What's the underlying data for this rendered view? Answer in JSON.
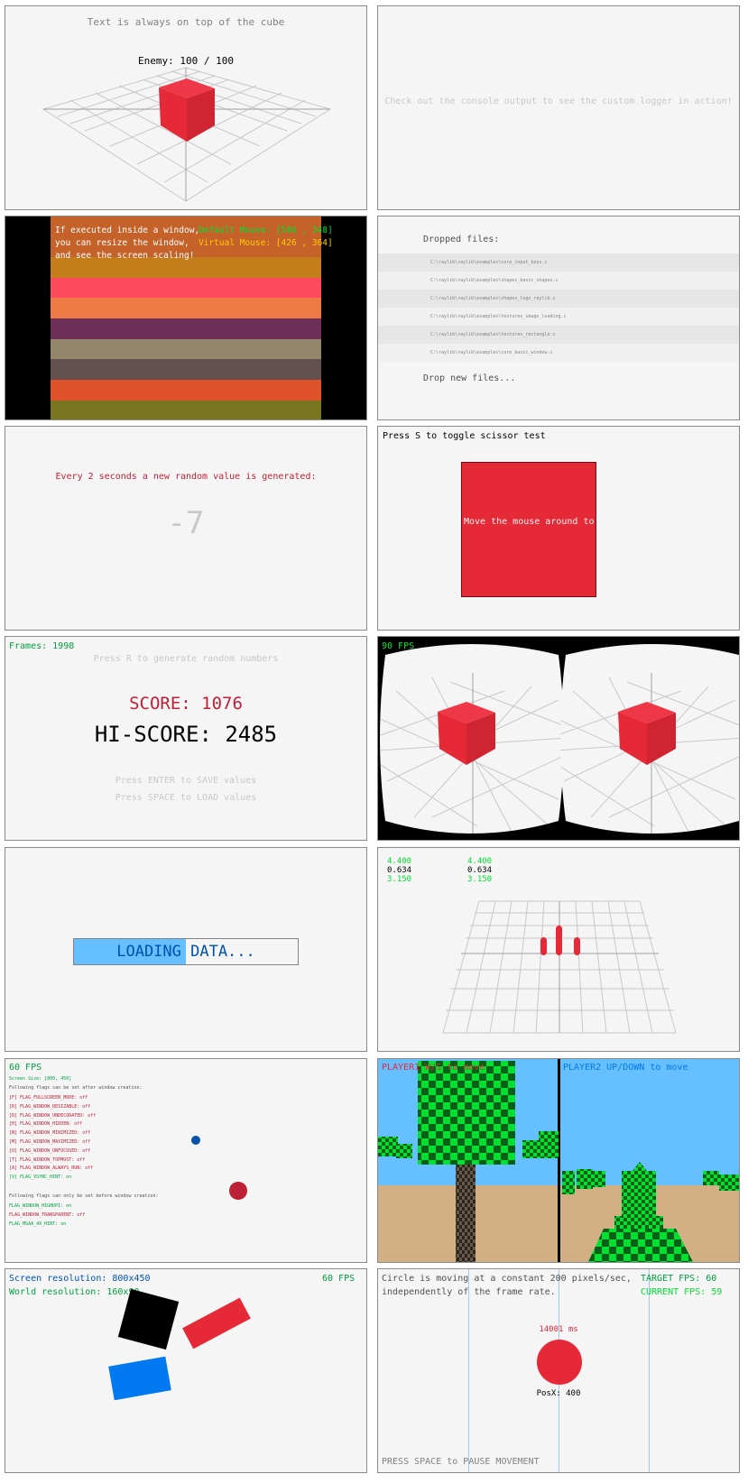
{
  "colors": {
    "red": "#e62937",
    "lightgray": "#c8c8c8",
    "gray": "#828282",
    "darkgray": "#505050",
    "lime": "#00e030",
    "green": "#00a040",
    "darkblue": "#0052ac",
    "blue": "#0079f1",
    "skyblue": "#66bfff",
    "maroon": "#be2137",
    "gold": "#ffcb00",
    "beige": "#d3b083",
    "black": "#000000",
    "raywhite": "#f5f5f5"
  },
  "p1": {
    "title": "Text is always on top of the cube",
    "enemy": "Enemy: 100 / 100"
  },
  "p2": {
    "message": "Check out the console output to see the custom logger in action!"
  },
  "p3": {
    "info_line1": "If executed inside a window,",
    "info_line2": "you can resize the window,",
    "info_line3": "and see the screen scaling!",
    "default_mouse": "Default Mouse: [500 , 348]",
    "virtual_mouse": "Virtual Mouse: [426 , 364]",
    "bar_colors": [
      "#c4622a",
      "#c57c1b",
      "#fe4a5c",
      "#ed7a44",
      "#6e3058",
      "#93866a",
      "#64504f",
      "#e0522a",
      "#787420"
    ]
  },
  "p4": {
    "title": "Dropped files:",
    "files": [
      "C:\\raylib\\raylib\\examples\\core_input_keys.c",
      "C:\\raylib\\raylib\\examples\\shapes_basic_shapes.c",
      "C:\\raylib\\raylib\\examples\\shapes_logo_raylib.c",
      "C:\\raylib\\raylib\\examples\\textures_image_loading.c",
      "C:\\raylib\\raylib\\examples\\textures_rectangle.c",
      "C:\\raylib\\raylib\\examples\\core_basic_window.c"
    ],
    "footer": "Drop new files..."
  },
  "p5": {
    "title": "Every 2 seconds a new random value is generated:",
    "value": "-7"
  },
  "p6": {
    "title": "Press S to toggle scissor test",
    "scissor_text": "Move the mouse around to r"
  },
  "p7": {
    "frames": "Frames: 1998",
    "hint": "Press R to generate random numbers",
    "score": "SCORE: 1076",
    "hiscore": "HI-SCORE: 2485",
    "save": "Press ENTER to SAVE values",
    "load": "Press SPACE to LOAD values"
  },
  "p8": {
    "fps": "90 FPS"
  },
  "p9": {
    "loading": "LOADING DATA...",
    "progress": 0.5
  },
  "p10": {
    "col1": [
      "4.400",
      "0.634",
      "3.150"
    ],
    "col2": [
      "4.400",
      "0.634",
      "3.150"
    ]
  },
  "p11": {
    "fps": "60 FPS",
    "screen_size": "Screen Size: [800, 450]",
    "after_title": "Following flags can be set after window creation:",
    "flags_after": [
      "[F] FLAG_FULLSCREEN_MODE: off",
      "[R] FLAG_WINDOW_RESIZABLE: off",
      "[D] FLAG_WINDOW_UNDECORATED: off",
      "[H] FLAG_WINDOW_HIDDEN: off",
      "[N] FLAG_WINDOW_MINIMIZED: off",
      "[M] FLAG_WINDOW_MAXIMIZED: off",
      "[U] FLAG_WINDOW_UNFOCUSED: off",
      "[T] FLAG_WINDOW_TOPMOST: off",
      "[A] FLAG_WINDOW_ALWAYS_RUN: off",
      "[V] FLAG_VSYNC_HINT: on"
    ],
    "before_title": "Following flags can only be set before window creation:",
    "flags_before": [
      "FLAG_WINDOW_HIGHDPI: on",
      "FLAG_WINDOW_TRANSPARENT: off",
      "FLAG_MSAA_4X_HINT: on"
    ]
  },
  "p12": {
    "player1": "PLAYER1 W/S to move",
    "player2": "PLAYER2 UP/DOWN to move"
  },
  "p13": {
    "screen_res": "Screen resolution: 800x450",
    "world_res": "World resolution: 160x90",
    "fps": "60 FPS"
  },
  "p14": {
    "line1": "Circle is moving at a constant 200 pixels/sec,",
    "line2": "independently of the frame rate.",
    "target_fps": "TARGET FPS: 60",
    "current_fps": "CURRENT FPS: 59",
    "time": "14001 ms",
    "posx": "PosX: 400",
    "footer": "PRESS SPACE to PAUSE MOVEMENT"
  }
}
